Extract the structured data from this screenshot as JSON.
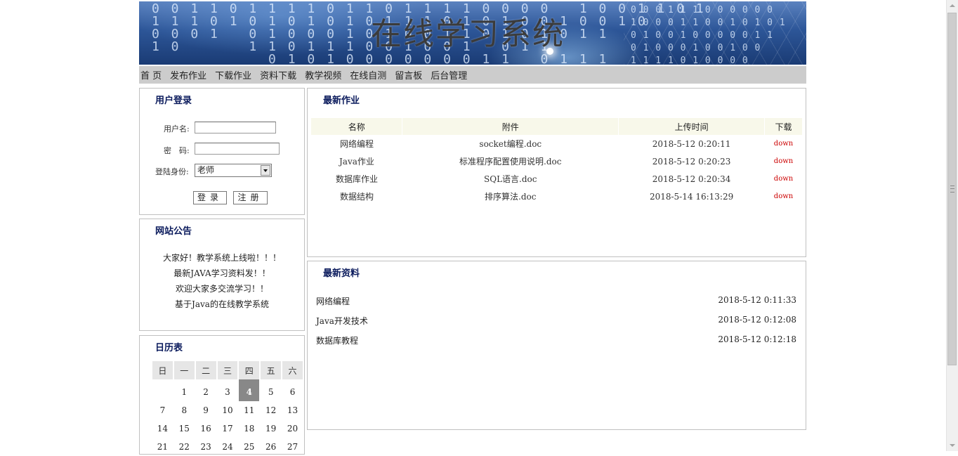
{
  "site": {
    "title": "在线学习系统"
  },
  "banner_digits": [
    "0 0 1 1 0 1 1 1 1 0 1 1 0 1 1 1 1 0 0 0 0   1 0 0 1 1 0 1",
    "1 1 1 0 1 0 1 0 1 0 1 0 1 1 1 0 1 0 1 0 0 1 0 0 1 0",
    "0 0 0 1   0 1 0 0 0 1 0 1 0 0 1 1 0 1 0 1 0 1 1",
    "1 0       1 1 0 1 1 1 0 0 1 0 0 1   0 1 1",
    "            0 1 0 1 0 0 0 0 0 0 0 1 1   0 1 1 1"
  ],
  "banner_digits_right": [
    "0 0 0 1 1 1 0 0 0 0 0 0",
    "1 0 0 0 1 1 0 0 1 0 1 0 1",
    "0 1 0 0 1 0 0 0 0 0 1 1",
    "0 1 0 0 0 1 0 0 1 0 0",
    "1 1 1 1 0 1 0 0 0 0"
  ],
  "nav": [
    "首 页",
    "发布作业",
    "下载作业",
    "资料下载",
    "教学视频",
    "在线自测",
    "留言板",
    "后台管理"
  ],
  "login": {
    "title": "用户登录",
    "username_label": "用户名:",
    "password_label": "密　码:",
    "role_label": "登陆身份:",
    "username_value": "",
    "password_value": "",
    "role_value": "老师",
    "login_button": "登录",
    "register_button": "注册"
  },
  "notice": {
    "title": "网站公告",
    "items": [
      "大家好！教学系统上线啦！！！",
      "最新JAVA学习资料发！！",
      "欢迎大家多交流学习！！",
      "基于Java的在线教学系统"
    ]
  },
  "calendar": {
    "title": "日历表",
    "weekdays": [
      "日",
      "一",
      "二",
      "三",
      "四",
      "五",
      "六"
    ],
    "weeks": [
      [
        "",
        "1",
        "2",
        "3",
        "4",
        "5",
        "6"
      ],
      [
        "7",
        "8",
        "9",
        "10",
        "11",
        "12",
        "13"
      ],
      [
        "14",
        "15",
        "16",
        "17",
        "18",
        "19",
        "20"
      ],
      [
        "21",
        "22",
        "23",
        "24",
        "25",
        "26",
        "27"
      ]
    ],
    "today": "4"
  },
  "homework": {
    "title": "最新作业",
    "headers": [
      "名称",
      "附件",
      "上传时间",
      "下载"
    ],
    "rows": [
      {
        "name": "网络编程",
        "file": "socket编程.doc",
        "time": "2018-5-12 0:20:11",
        "action": "down"
      },
      {
        "name": "Java作业",
        "file": "标准程序配置使用说明.doc",
        "time": "2018-5-12 0:20:23",
        "action": "down"
      },
      {
        "name": "数据库作业",
        "file": "SQL语言.doc",
        "time": "2018-5-12 0:20:34",
        "action": "down"
      },
      {
        "name": "数据结构",
        "file": "排序算法.doc",
        "time": "2018-5-14 16:13:29",
        "action": "down"
      }
    ]
  },
  "resources": {
    "title": "最新资料",
    "items": [
      {
        "name": "网络编程",
        "time": "2018-5-12 0:11:33"
      },
      {
        "name": "Java开发技术",
        "time": "2018-5-12 0:12:08"
      },
      {
        "name": "数据库教程",
        "time": "2018-5-12 0:12:18"
      }
    ]
  }
}
